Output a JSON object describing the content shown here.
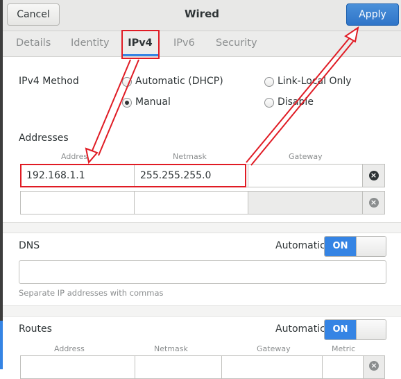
{
  "header": {
    "cancel_label": "Cancel",
    "title": "Wired",
    "apply_label": "Apply"
  },
  "tabs": [
    {
      "label": "Details",
      "active": false
    },
    {
      "label": "Identity",
      "active": false
    },
    {
      "label": "IPv4",
      "active": true
    },
    {
      "label": "IPv6",
      "active": false
    },
    {
      "label": "Security",
      "active": false
    }
  ],
  "ipv4_method": {
    "label": "IPv4 Method",
    "options": [
      {
        "label": "Automatic (DHCP)",
        "selected": false
      },
      {
        "label": "Link-Local Only",
        "selected": false
      },
      {
        "label": "Manual",
        "selected": true
      },
      {
        "label": "Disable",
        "selected": false
      }
    ]
  },
  "addresses": {
    "title": "Addresses",
    "columns": [
      "Address",
      "Netmask",
      "Gateway"
    ],
    "rows": [
      {
        "address": "192.168.1.1",
        "netmask": "255.255.255.0",
        "gateway": ""
      },
      {
        "address": "",
        "netmask": "",
        "gateway": ""
      }
    ]
  },
  "dns": {
    "title": "DNS",
    "automatic_label": "Automatic",
    "toggle_label": "ON",
    "value": "",
    "hint": "Separate IP addresses with commas"
  },
  "routes": {
    "title": "Routes",
    "automatic_label": "Automatic",
    "toggle_label": "ON",
    "columns": [
      "Address",
      "Netmask",
      "Gateway",
      "Metric"
    ]
  },
  "colors": {
    "accent": "#3584e4",
    "annotation_red": "#e01b24"
  },
  "icons": {
    "clear": "clear-circle-icon"
  }
}
